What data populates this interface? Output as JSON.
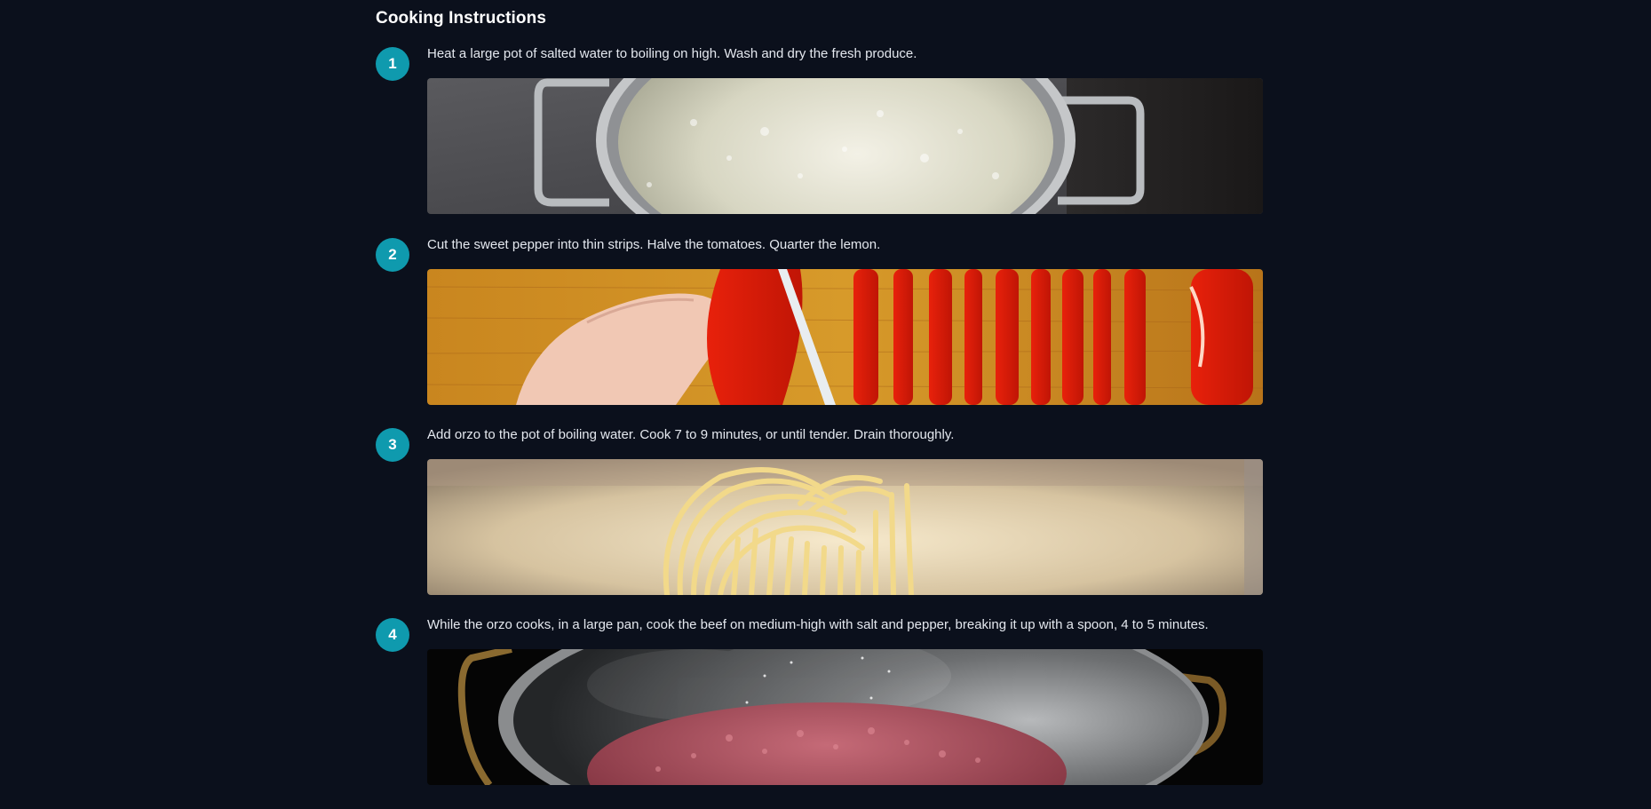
{
  "section": {
    "title": "Cooking Instructions"
  },
  "steps": [
    {
      "number": "1",
      "text": "Heat a large pot of salted water to boiling on high. Wash and dry the fresh produce.",
      "image": "boiling-water-pot"
    },
    {
      "number": "2",
      "text": "Cut the sweet pepper into thin strips. Halve the tomatoes. Quarter the lemon.",
      "image": "slicing-red-pepper"
    },
    {
      "number": "3",
      "text": "Add orzo to the pot of boiling water. Cook 7 to 9 minutes, or until tender. Drain thoroughly.",
      "image": "pasta-in-pot"
    },
    {
      "number": "4",
      "text": "While the orzo cooks, in a large pan, cook the beef on medium-high with salt and pepper, breaking it up with a spoon, 4 to 5 minutes.",
      "image": "ground-beef-in-wok"
    }
  ],
  "colors": {
    "background": "#0b101c",
    "step_badge": "#0f9aae",
    "text": "#e4e8ef"
  }
}
